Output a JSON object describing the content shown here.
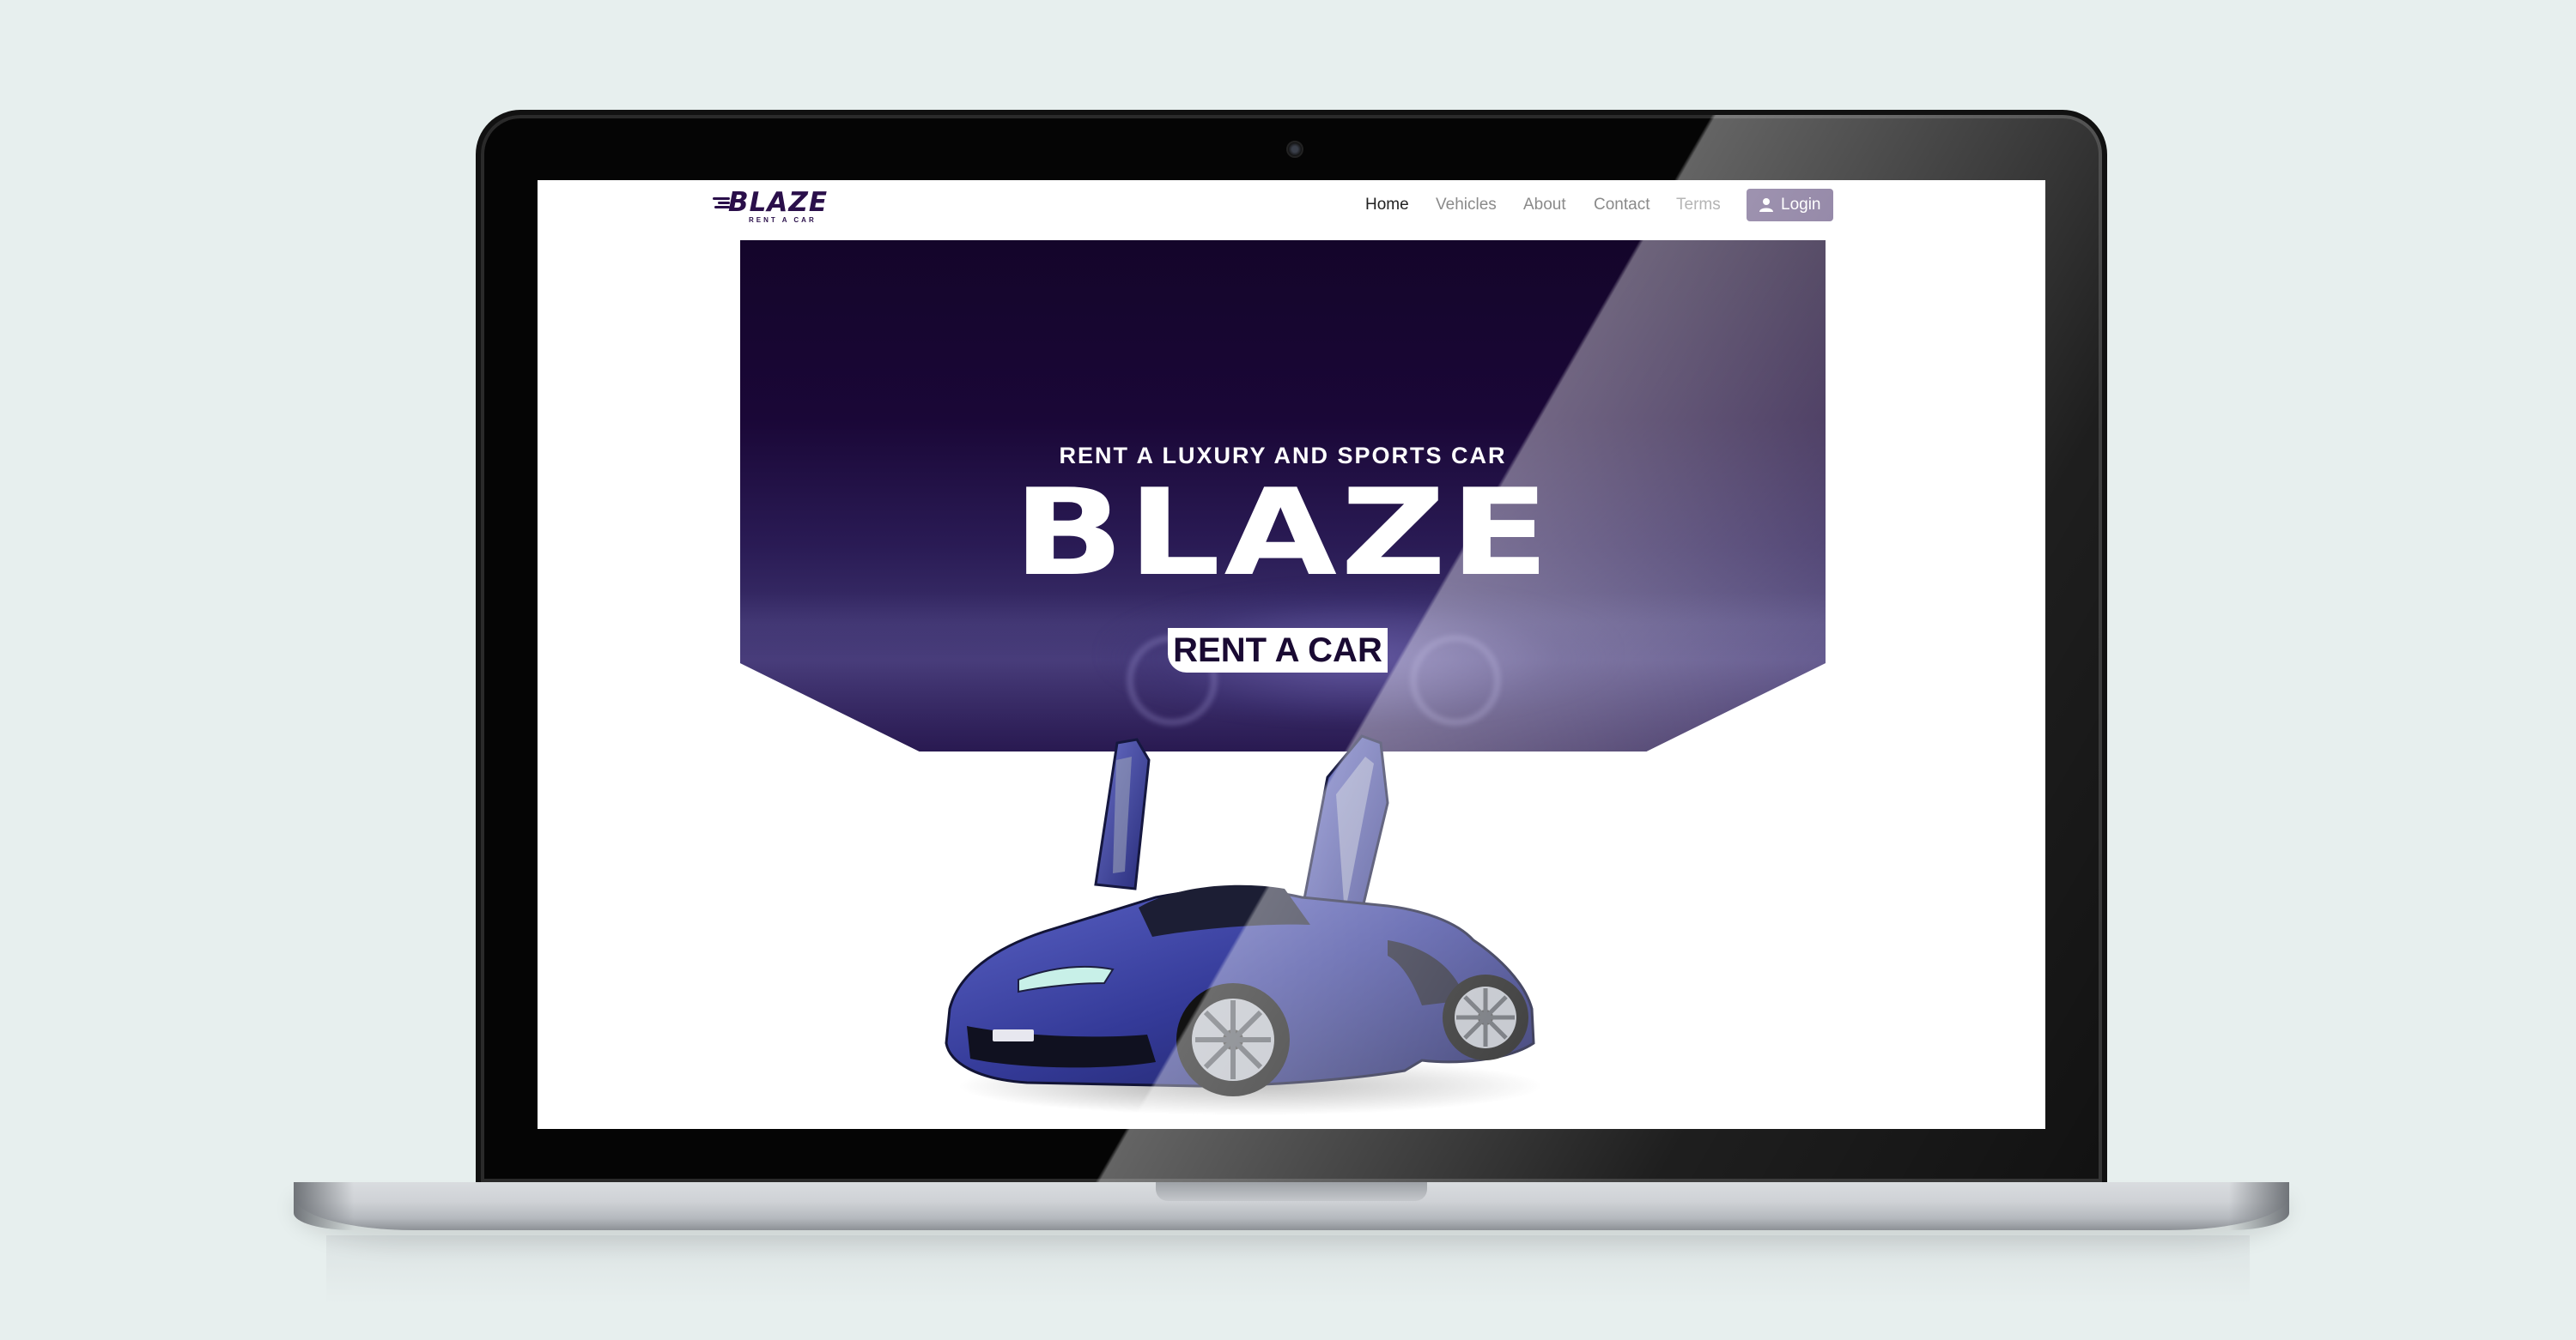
{
  "site": {
    "logo": {
      "word": "BLAZE",
      "subtitle": "RENT A CAR"
    },
    "nav": {
      "items": [
        {
          "label": "Home",
          "active": true
        },
        {
          "label": "Vehicles",
          "active": false
        },
        {
          "label": "About",
          "active": false
        },
        {
          "label": "Contact",
          "active": false
        },
        {
          "label": "Terms",
          "active": false
        }
      ],
      "login_label": "Login"
    },
    "hero": {
      "tagline": "RENT A LUXURY AND SPORTS CAR",
      "title": "BLAZE",
      "badge": "RENT A CAR"
    }
  },
  "colors": {
    "background": "#e7efee",
    "hero_dark": "#14052a",
    "hero_mid": "#2a1b55",
    "login_button": "#6b5a86",
    "car_body": "#3a3f9a"
  }
}
